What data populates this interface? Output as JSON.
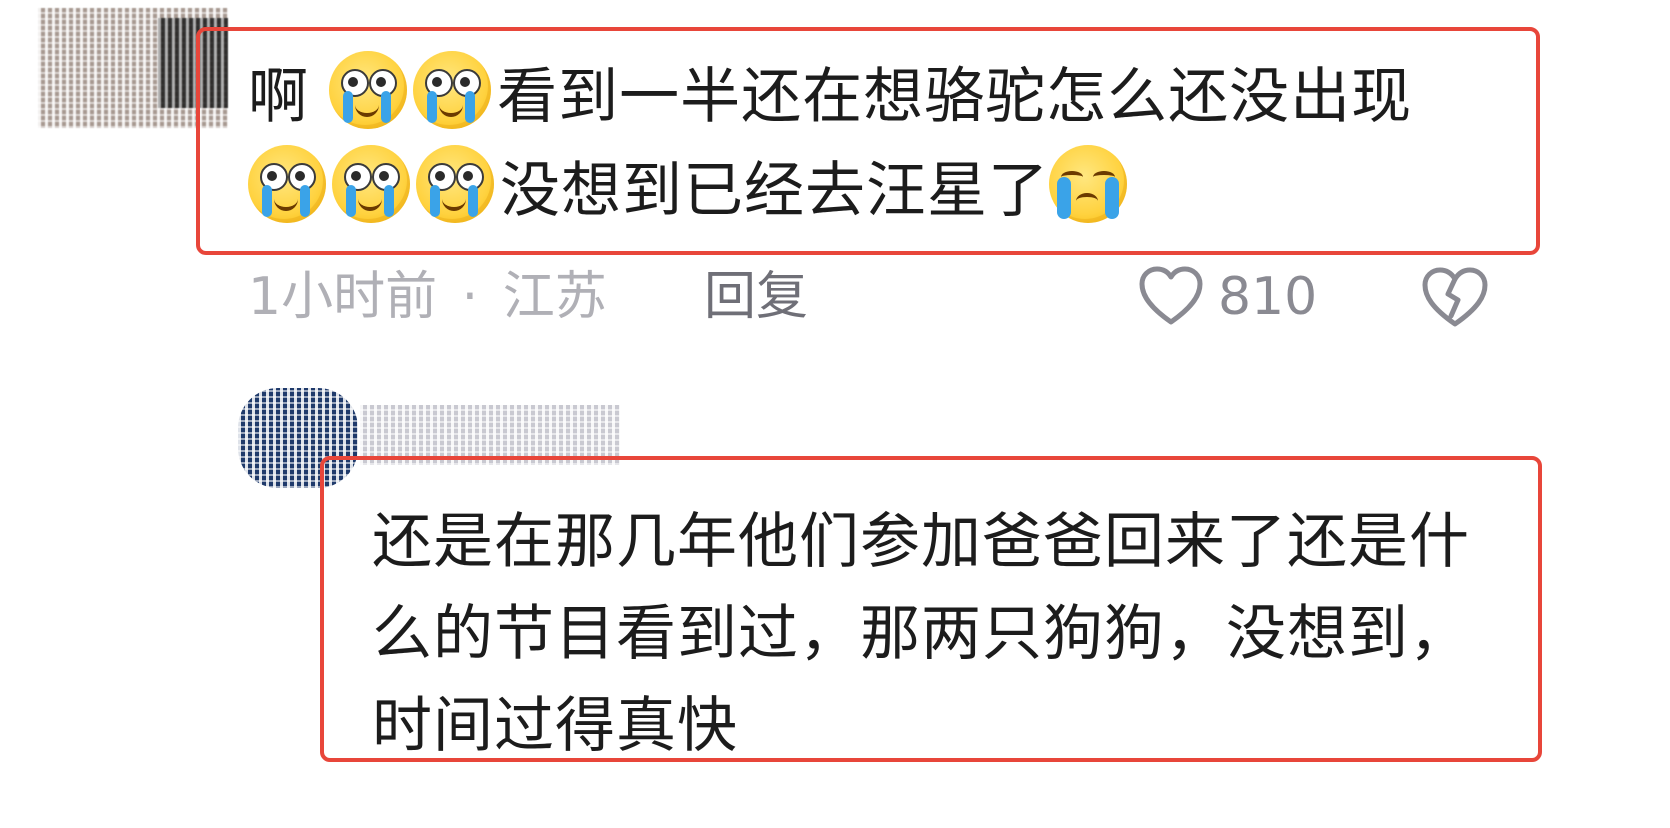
{
  "comments": [
    {
      "text_line1_prefix": "啊",
      "text_line1_suffix": "看到一半还在想骆驼怎么还没出现",
      "text_line2_suffix": "没想到已经去汪星了",
      "time": "1小时前",
      "separator": "·",
      "location": "江苏",
      "reply_label": "回复",
      "like_count": "810",
      "emojis": [
        "crying-emoji",
        "crying-emoji",
        "crying-emoji",
        "crying-emoji",
        "crying-emoji",
        "loudly-crying-emoji"
      ]
    },
    {
      "text": "还是在那几年他们参加爸爸回来了还是什么的节目看到过，那两只狗狗，没想到，时间过得真快"
    }
  ],
  "colors": {
    "highlight": "#e8463a",
    "meta_text": "#b0b0b6",
    "reply_text": "#6f6f77"
  }
}
